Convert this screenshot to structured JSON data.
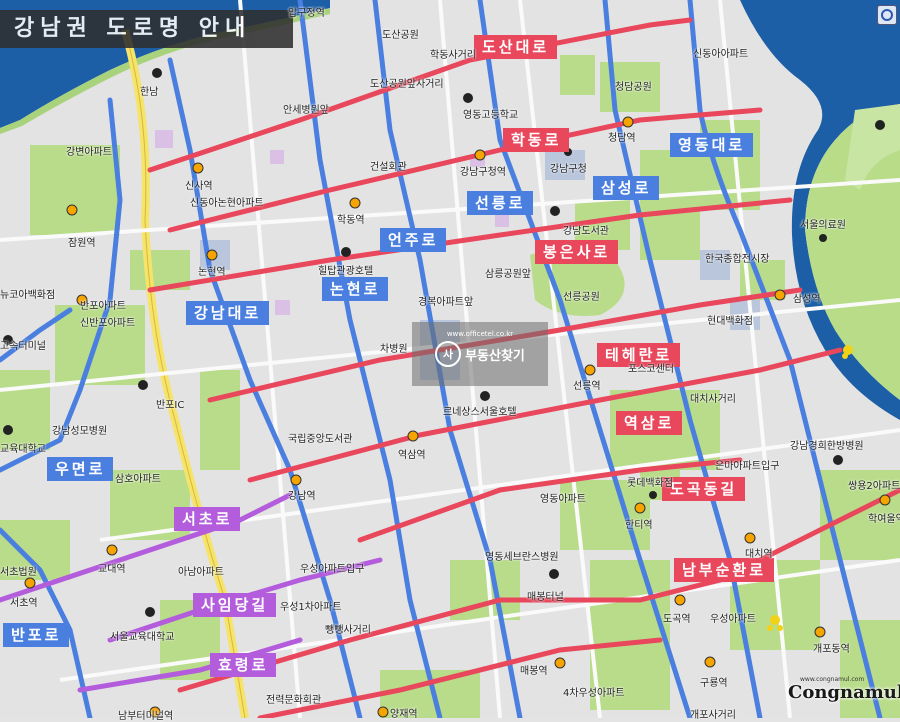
{
  "title": "강남권 도로명 안내",
  "roads": {
    "dosandaero": "도산대로",
    "hakdongro": "학동로",
    "yeongdongdaero": "영동대로",
    "samseongro": "삼성로",
    "seolleungro": "선릉로",
    "eonjuro": "언주로",
    "bongeunsaro": "봉은사로",
    "nonhyeonro": "논현로",
    "gangnamdaero": "강남대로",
    "teheranro": "테헤란로",
    "yeoksamro": "역삼로",
    "dogokdonggil": "도곡동길",
    "uyeonro": "우면로",
    "seochoro": "서초로",
    "saimdanggil": "사임당길",
    "nambusunhwanro": "남부순환로",
    "banporo": "반포로",
    "hyoryeongro": "효령로"
  },
  "places": {
    "apgujeong": "압구정역",
    "dosanpark": "도산공원",
    "hakdong_intersection": "학동사거리",
    "sindong_apt": "신동아아파트",
    "dosanpark_intersection": "도산공원앞사거리",
    "hanseo_hospital": "안세병원앞",
    "yeongdong_highschool": "영동고등학교",
    "cheongdam_park": "청담공원",
    "cheongdam_stn": "청담역",
    "gangbyeon_apt": "강변아파트",
    "geonseol_hall": "건설회관",
    "gangnam_gu_stn": "강남구청역",
    "gangnam_gu_office": "강남구청",
    "sinsa": "신사역",
    "sindong_nonhyeon_apt": "신동아논현아파트",
    "hakdong_stn": "학동역",
    "gangnam_library": "강남도서관",
    "seoul_medical": "서울의료원",
    "jamwon": "잠원역",
    "hiltop_hotel": "힐탑관광호텔",
    "trade_center": "한국종합전시장",
    "nonhyeon_stn": "논현역",
    "seolleung_park_stn": "삼릉공원앞",
    "newcore": "뉴코아백화점",
    "banpo_apt": "반포아파트",
    "sinbanpo_apt": "신반포아파트",
    "kyungbok_apt": "경복아파트앞",
    "seolleung_park": "선릉공원",
    "samseong_stn": "삼성역",
    "hyundai_dept": "현대백화점",
    "express_terminal": "고속터미널",
    "chabyeongwon": "차병원",
    "posco_center": "포스코센터",
    "seolleung_stn": "선릉역",
    "banpo_ic": "반포IC",
    "daechi_intersection": "대치사거리",
    "renaissance": "르네상스서울호텔",
    "gangnam_hospital": "강남성모병원",
    "kyoyuk_univ": "교육대학교",
    "national_library": "국립중앙도서관",
    "yeoksam_stn": "역삼역",
    "gangnam_hangbang": "강남경희한방병원",
    "samho_apt": "삼호아파트",
    "gangnam_stn": "강남역",
    "eunma_apt_entrance": "은마아파트입구",
    "lotte_dept": "롯데백화점",
    "hanti_stn": "한티역",
    "yeongdong_apt": "영동아파트",
    "ssangyong_apt": "쌍용2아파트",
    "hakyeo_stn": "학여울역",
    "daechi_stn": "대치역",
    "yeongdong_severance": "영동세브란스병원",
    "seocho_stn_1": "서초법원",
    "gyodae_stn": "교대역",
    "anam_apt": "아남아파트",
    "useong_apt_entrance": "우성아파트입구",
    "maebong_tunnel": "매봉터널",
    "seocho_stn": "서초역",
    "useong1_apt": "우성1차아파트",
    "dogok_stn": "도곡역",
    "useong_apt": "우성아파트",
    "seoul_edu_office": "서울교육대학교",
    "ppaengppaeng": "뺑뺑사거리",
    "gaepo_stn": "개포동역",
    "maebong_stn": "매봉역",
    "guryong_stn": "구룡역",
    "useong4_apt": "4차우성아파트",
    "art_center": "전력문화회관",
    "yangjae_stn": "양재역",
    "nambu_terminal": "남부터미널역",
    "gaepo_intersection": "개포사거리",
    "hanam": "한남"
  },
  "watermark": {
    "text": "부동산찾기",
    "logo": "사",
    "url": "www.officetel.co.kr"
  },
  "brand": {
    "name": "Congnamul",
    "sub": "www.congnamul.com"
  },
  "icons": {
    "zoom": "magnifier-icon",
    "subway": "subway-station-icon",
    "hotel": "hotel-icon"
  },
  "colors": {
    "road_red": "#e8475c",
    "road_blue": "#4a7fe0",
    "road_purple": "#b35cdc",
    "river": "#1d5fa6",
    "green": "#b9dc8a"
  }
}
